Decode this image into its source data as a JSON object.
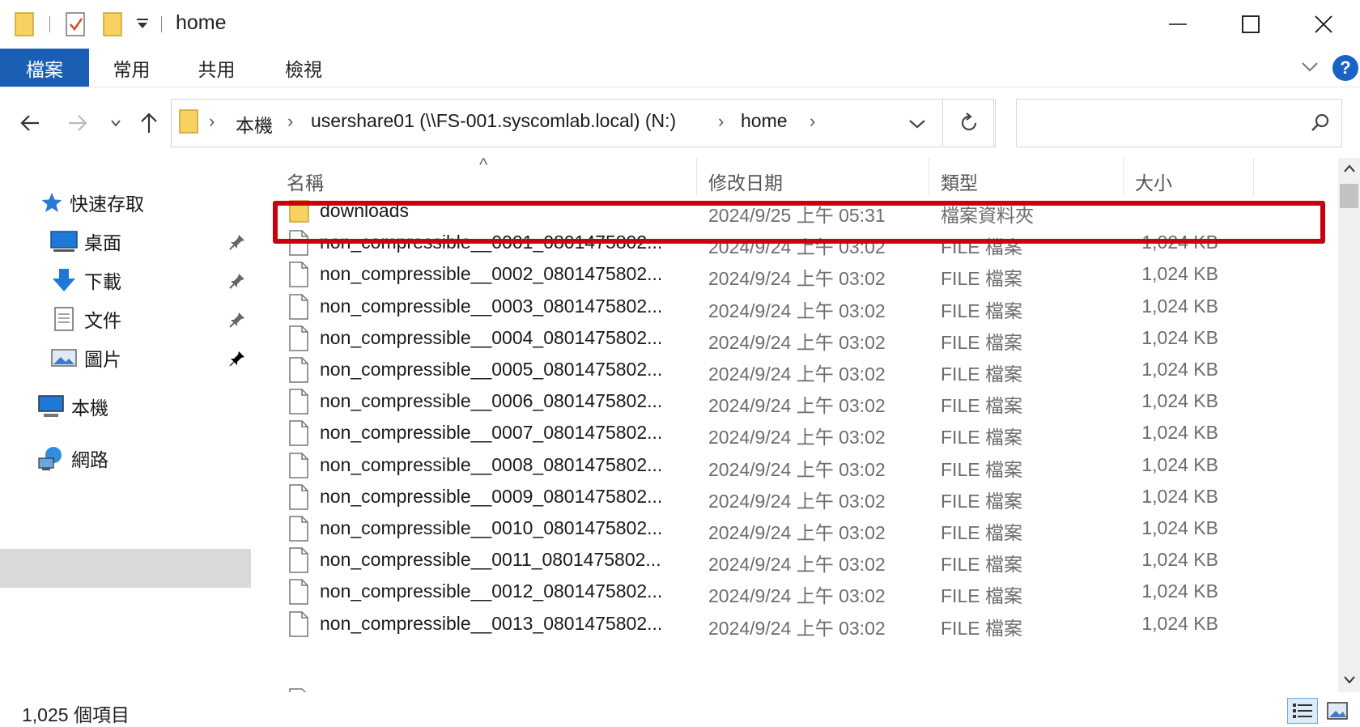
{
  "window": {
    "title": "home"
  },
  "ribbon": {
    "tabs": [
      {
        "label": "檔案",
        "active": true
      },
      {
        "label": "常用",
        "active": false
      },
      {
        "label": "共用",
        "active": false
      },
      {
        "label": "檢視",
        "active": false
      }
    ],
    "help_label": "?"
  },
  "address": {
    "breadcrumbs": [
      "本機",
      "usershare01 (\\\\FS-001.syscomlab.local) (N:)",
      "home"
    ],
    "search_placeholder": ""
  },
  "nav_pane": {
    "quick_access_label": "快速存取",
    "quick_items": [
      {
        "label": "桌面",
        "icon": "desktop-icon",
        "pinned": true
      },
      {
        "label": "下載",
        "icon": "download-arrow-icon",
        "pinned": true
      },
      {
        "label": "文件",
        "icon": "document-icon",
        "pinned": true
      },
      {
        "label": "圖片",
        "icon": "picture-icon",
        "pinned": true
      }
    ],
    "this_pc_label": "本機",
    "network_label": "網路"
  },
  "file_list": {
    "columns": [
      "名稱",
      "修改日期",
      "類型",
      "大小"
    ],
    "sort_indicator": "^",
    "rows": [
      {
        "name": "downloads",
        "date": "2024/9/25 上午 05:31",
        "type": "檔案資料夾",
        "size": "",
        "kind": "folder"
      },
      {
        "name": "non_compressible__0001_0801475802...",
        "date": "2024/9/24 上午 03:02",
        "type": "FILE 檔案",
        "size": "1,024 KB",
        "kind": "file"
      },
      {
        "name": "non_compressible__0002_0801475802...",
        "date": "2024/9/24 上午 03:02",
        "type": "FILE 檔案",
        "size": "1,024 KB",
        "kind": "file"
      },
      {
        "name": "non_compressible__0003_0801475802...",
        "date": "2024/9/24 上午 03:02",
        "type": "FILE 檔案",
        "size": "1,024 KB",
        "kind": "file"
      },
      {
        "name": "non_compressible__0004_0801475802...",
        "date": "2024/9/24 上午 03:02",
        "type": "FILE 檔案",
        "size": "1,024 KB",
        "kind": "file"
      },
      {
        "name": "non_compressible__0005_0801475802...",
        "date": "2024/9/24 上午 03:02",
        "type": "FILE 檔案",
        "size": "1,024 KB",
        "kind": "file"
      },
      {
        "name": "non_compressible__0006_0801475802...",
        "date": "2024/9/24 上午 03:02",
        "type": "FILE 檔案",
        "size": "1,024 KB",
        "kind": "file"
      },
      {
        "name": "non_compressible__0007_0801475802...",
        "date": "2024/9/24 上午 03:02",
        "type": "FILE 檔案",
        "size": "1,024 KB",
        "kind": "file"
      },
      {
        "name": "non_compressible__0008_0801475802...",
        "date": "2024/9/24 上午 03:02",
        "type": "FILE 檔案",
        "size": "1,024 KB",
        "kind": "file"
      },
      {
        "name": "non_compressible__0009_0801475802...",
        "date": "2024/9/24 上午 03:02",
        "type": "FILE 檔案",
        "size": "1,024 KB",
        "kind": "file"
      },
      {
        "name": "non_compressible__0010_0801475802...",
        "date": "2024/9/24 上午 03:02",
        "type": "FILE 檔案",
        "size": "1,024 KB",
        "kind": "file"
      },
      {
        "name": "non_compressible__0011_0801475802...",
        "date": "2024/9/24 上午 03:02",
        "type": "FILE 檔案",
        "size": "1,024 KB",
        "kind": "file"
      },
      {
        "name": "non_compressible__0012_0801475802...",
        "date": "2024/9/24 上午 03:02",
        "type": "FILE 檔案",
        "size": "1,024 KB",
        "kind": "file"
      },
      {
        "name": "non_compressible__0013_0801475802...",
        "date": "2024/9/24 上午 03:02",
        "type": "FILE 檔案",
        "size": "1,024 KB",
        "kind": "file"
      }
    ]
  },
  "status": {
    "item_count": "1,025 個項目"
  },
  "colors": {
    "accent_tab": "#1a5fb4",
    "highlight": "#c8000f",
    "selected_nav": "#d9d9d9",
    "folder_yellow": "#f7d261"
  }
}
